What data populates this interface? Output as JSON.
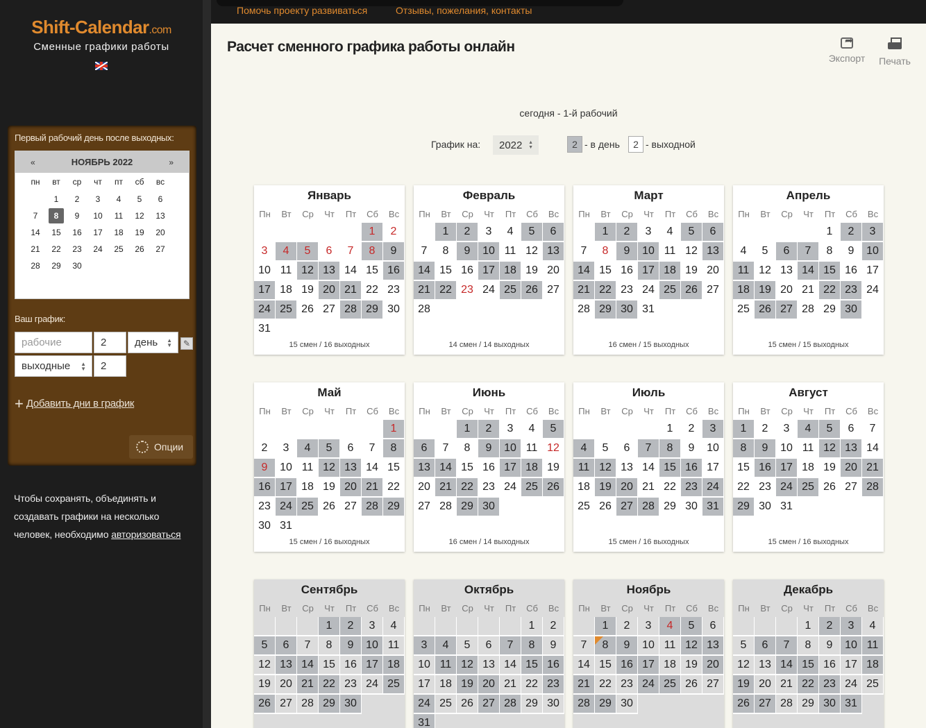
{
  "site": {
    "logo": "Shift-Calendar",
    "logo_suffix": ".com",
    "tagline": "Сменные графики работы"
  },
  "topnav": [
    "Помочь проекту развиваться",
    "Отзывы, пожелания, контакты"
  ],
  "sidebar": {
    "first_day_title": "Первый рабочий день после выходных:",
    "mini_calendar": {
      "prev": "«",
      "next": "»",
      "title": "НОЯБРЬ 2022",
      "weekdays": [
        "пн",
        "вт",
        "ср",
        "чт",
        "пт",
        "сб",
        "вс"
      ],
      "offset": 1,
      "days_in_month": 30,
      "selected": 8
    },
    "schedule_label": "Ваш график:",
    "work_field_placeholder": "рабочие",
    "work_count": "2",
    "unit_select": "день",
    "off_select": "выходные",
    "off_count": "2",
    "add_days": "Добавить дни в график",
    "options": "Опции",
    "auth_note": "Чтобы сохранять, объединять и создавать графики на несколько человек, необходимо",
    "auth_link": "авторизоваться"
  },
  "main": {
    "title": "Расчет сменного графика работы онлайн",
    "export": "Экспорт",
    "print": "Печать",
    "today": "сегодня - 1-й рабочий",
    "schedule_for": "График на:",
    "year": "2022",
    "work_days": "2",
    "work_label": "- в день",
    "off_days": "2",
    "off_label": "- выходной"
  },
  "weekdays": [
    "Пн",
    "Вт",
    "Ср",
    "Чт",
    "Пт",
    "Сб",
    "Вс"
  ],
  "calendar": {
    "year": 2022,
    "today": {
      "month": 11,
      "day": 8
    },
    "months": [
      {
        "name": "Январь",
        "offset": 5,
        "days": 31,
        "holidays": [
          1,
          2,
          3,
          4,
          5,
          6,
          7,
          8
        ],
        "footer": "15 смен / 16 выходных"
      },
      {
        "name": "Февраль",
        "offset": 1,
        "days": 28,
        "holidays": [
          23
        ],
        "footer": "14 смен / 14 выходных"
      },
      {
        "name": "Март",
        "offset": 1,
        "days": 31,
        "holidays": [
          8
        ],
        "footer": "16 смен / 15 выходных"
      },
      {
        "name": "Апрель",
        "offset": 4,
        "days": 30,
        "holidays": [],
        "footer": "15 смен / 15 выходных"
      },
      {
        "name": "Май",
        "offset": 6,
        "days": 31,
        "holidays": [
          1,
          9
        ],
        "footer": "15 смен / 16 выходных"
      },
      {
        "name": "Июнь",
        "offset": 2,
        "days": 30,
        "holidays": [
          12
        ],
        "footer": "16 смен / 14 выходных"
      },
      {
        "name": "Июль",
        "offset": 4,
        "days": 31,
        "holidays": [],
        "footer": "15 смен / 16 выходных"
      },
      {
        "name": "Август",
        "offset": 0,
        "days": 31,
        "holidays": [],
        "footer": "15 смен / 16 выходных"
      },
      {
        "name": "Сентябрь",
        "offset": 3,
        "days": 30,
        "holidays": [],
        "footer": ""
      },
      {
        "name": "Октябрь",
        "offset": 5,
        "days": 31,
        "holidays": [],
        "footer": ""
      },
      {
        "name": "Ноябрь",
        "offset": 1,
        "days": 30,
        "holidays": [
          4
        ],
        "footer": ""
      },
      {
        "name": "Декабрь",
        "offset": 3,
        "days": 31,
        "holidays": [],
        "footer": ""
      }
    ]
  },
  "colors": {
    "accent": "#e08a2e",
    "work_cell": "#b7babe",
    "holiday": "#c62828",
    "sidebar_panel": "#5e3c14"
  }
}
